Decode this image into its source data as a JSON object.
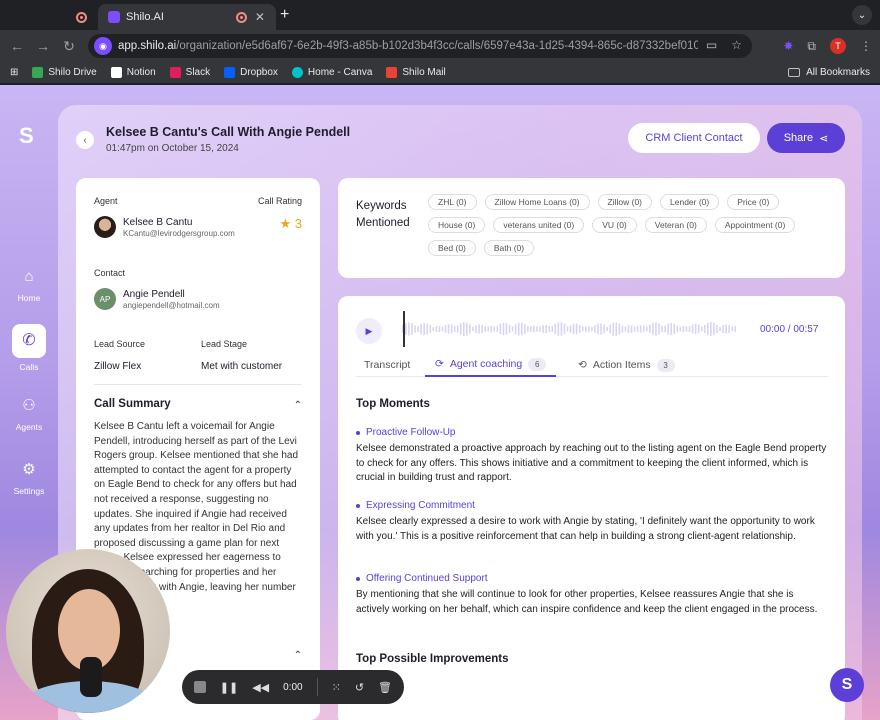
{
  "browser": {
    "active_tab_title": "Shilo.AI",
    "url_host": "app.shilo.ai",
    "url_path": "/organization/e5d6af67-6e2b-49f3-a85b-b102d3b4f3cc/calls/6597e43a-1d25-4394-865c-d87332bef010",
    "profile_initial": "T",
    "bookmarks": [
      "Shilo Drive",
      "Notion",
      "Slack",
      "Dropbox",
      "Home - Canva",
      "Shilo Mail"
    ],
    "all_bookmarks": "All Bookmarks"
  },
  "nav": {
    "items": [
      {
        "label": "Home",
        "icon": "home-icon"
      },
      {
        "label": "Calls",
        "icon": "phone-icon"
      },
      {
        "label": "Agents",
        "icon": "people-icon"
      },
      {
        "label": "Settings",
        "icon": "gear-icon"
      }
    ]
  },
  "header": {
    "title": "Kelsee B Cantu's Call With Angie Pendell",
    "date": "01:47pm on October 15, 2024",
    "crm_button": "CRM Client Contact",
    "share_button": "Share"
  },
  "details": {
    "agent_label": "Agent",
    "agent_name": "Kelsee B Cantu",
    "agent_email": "KCantu@levirodgersgroup.com",
    "rating_label": "Call Rating",
    "rating_value": "3",
    "contact_label": "Contact",
    "contact_initials": "AP",
    "contact_name": "Angie Pendell",
    "contact_email": "angiependell@hotmail.com",
    "lead_source_label": "Lead Source",
    "lead_source": "Zillow Flex",
    "lead_stage_label": "Lead Stage",
    "lead_stage": "Met with customer",
    "summary_title": "Call Summary",
    "summary_text": "Kelsee B Cantu left a voicemail for Angie Pendell, introducing herself as part of the Levi Rogers group. Kelsee mentioned that she had attempted to contact the agent for a property on Eagle Bend to check for any offers but had not received a response, suggesting no updates. She inquired if Angie had received any updates from her realtor in Del Rio and proposed discussing a game plan for next steps. Kelsee expressed her eagerness to continue searching for properties and her desire to work with Angie, leaving her number for a callback."
  },
  "keywords": {
    "title": "Keywords Mentioned",
    "chips": [
      "ZHL (0)",
      "Zillow Home Loans (0)",
      "Zillow (0)",
      "Lender (0)",
      "Price (0)",
      "House (0)",
      "veterans united (0)",
      "VU (0)",
      "Veteran (0)",
      "Appointment (0)",
      "Bed (0)",
      "Bath (0)"
    ]
  },
  "player": {
    "time": "00:00 / 00:57",
    "progress": 0
  },
  "tabs": [
    {
      "label": "Transcript",
      "count": ""
    },
    {
      "label": "Agent coaching",
      "count": "6"
    },
    {
      "label": "Action Items",
      "count": "3"
    }
  ],
  "coaching": {
    "top_moments_title": "Top Moments",
    "moments": [
      {
        "title": "Proactive Follow-Up",
        "body": "Kelsee demonstrated a proactive approach by reaching out to the listing agent on the Eagle Bend property to check for any offers. This shows initiative and a commitment to keeping the client informed, which is crucial in building trust and rapport."
      },
      {
        "title": "Expressing Commitment",
        "body": "Kelsee clearly expressed a desire to work with Angie by stating, 'I definitely want the opportunity to work with you.' This is a positive reinforcement that can help in building a strong client-agent relationship."
      },
      {
        "title": "Offering Continued Support",
        "body": "By mentioning that she will continue to look for other properties, Kelsee reassures Angie that she is actively working on her behalf, which can inspire confidence and keep the client engaged in the process."
      }
    ],
    "improvements_title": "Top Possible Improvements"
  },
  "recorder": {
    "time": "0:00"
  },
  "colors": {
    "accent": "#5b3fd6",
    "star": "#e6a817"
  }
}
